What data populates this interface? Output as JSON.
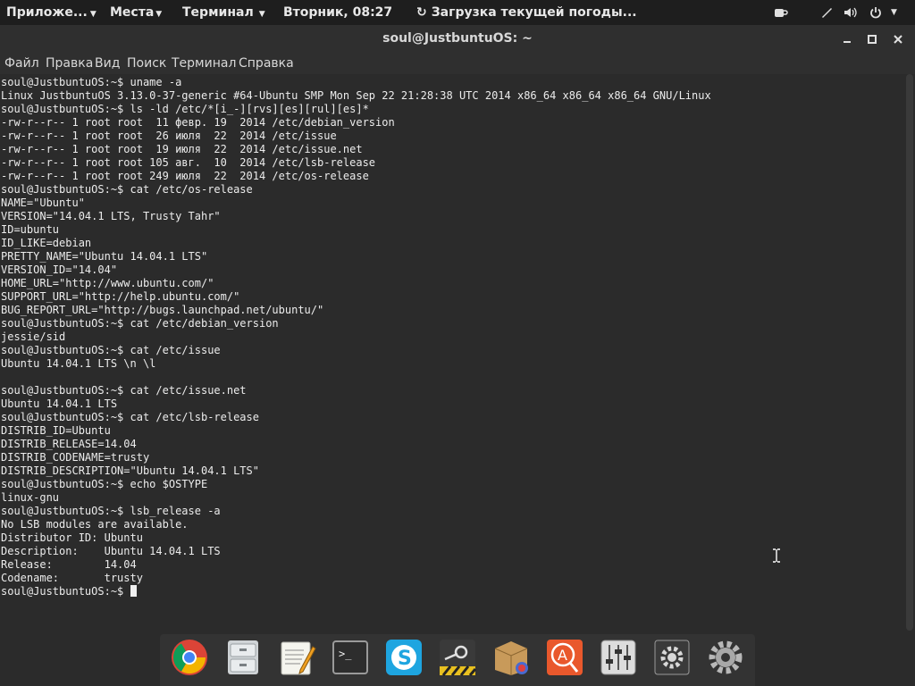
{
  "top_panel": {
    "applications": "Приложе...",
    "places": "Места",
    "terminal_menu": "Терминал",
    "clock": "Вторник, 08:27",
    "weather": "Загрузка текущей погоды..."
  },
  "window": {
    "title": "soul@JustbuntuOS: ~"
  },
  "menu": {
    "items": [
      "Файл",
      "Правка",
      "Вид",
      "Поиск",
      "Терминал",
      "Справка"
    ]
  },
  "terminal": {
    "lines": [
      "soul@JustbuntuOS:~$ uname -a",
      "Linux JustbuntuOS 3.13.0-37-generic #64-Ubuntu SMP Mon Sep 22 21:28:38 UTC 2014 x86_64 x86_64 x86_64 GNU/Linux",
      "soul@JustbuntuOS:~$ ls -ld /etc/*[i_-][rvs][es][rul][es]*",
      "-rw-r--r-- 1 root root  11 февр. 19  2014 /etc/debian_version",
      "-rw-r--r-- 1 root root  26 июля  22  2014 /etc/issue",
      "-rw-r--r-- 1 root root  19 июля  22  2014 /etc/issue.net",
      "-rw-r--r-- 1 root root 105 авг.  10  2014 /etc/lsb-release",
      "-rw-r--r-- 1 root root 249 июля  22  2014 /etc/os-release",
      "soul@JustbuntuOS:~$ cat /etc/os-release",
      "NAME=\"Ubuntu\"",
      "VERSION=\"14.04.1 LTS, Trusty Tahr\"",
      "ID=ubuntu",
      "ID_LIKE=debian",
      "PRETTY_NAME=\"Ubuntu 14.04.1 LTS\"",
      "VERSION_ID=\"14.04\"",
      "HOME_URL=\"http://www.ubuntu.com/\"",
      "SUPPORT_URL=\"http://help.ubuntu.com/\"",
      "BUG_REPORT_URL=\"http://bugs.launchpad.net/ubuntu/\"",
      "soul@JustbuntuOS:~$ cat /etc/debian_version",
      "jessie/sid",
      "soul@JustbuntuOS:~$ cat /etc/issue",
      "Ubuntu 14.04.1 LTS \\n \\l",
      "",
      "soul@JustbuntuOS:~$ cat /etc/issue.net",
      "Ubuntu 14.04.1 LTS",
      "soul@JustbuntuOS:~$ cat /etc/lsb-release",
      "DISTRIB_ID=Ubuntu",
      "DISTRIB_RELEASE=14.04",
      "DISTRIB_CODENAME=trusty",
      "DISTRIB_DESCRIPTION=\"Ubuntu 14.04.1 LTS\"",
      "soul@JustbuntuOS:~$ echo $OSTYPE",
      "linux-gnu",
      "soul@JustbuntuOS:~$ lsb_release -a",
      "No LSB modules are available.",
      "Distributor ID:\tUbuntu",
      "Description:\tUbuntu 14.04.1 LTS",
      "Release:\t14.04",
      "Codename:\ttrusty"
    ],
    "prompt": "soul@JustbuntuOS:~$ "
  },
  "dock": {
    "apps": [
      "chrome-icon",
      "file-cabinet-icon",
      "text-editor-icon",
      "terminal-icon",
      "skype-icon",
      "steam-icon",
      "package-installer-icon",
      "app-search-icon",
      "mixer-icon",
      "system-settings-icon",
      "gear-icon"
    ]
  },
  "colors": {
    "panel": "#1e1e1e",
    "window": "#2f2f2f",
    "terminal_bg": "#2b2b2b",
    "terminal_fg": "#ececec"
  }
}
